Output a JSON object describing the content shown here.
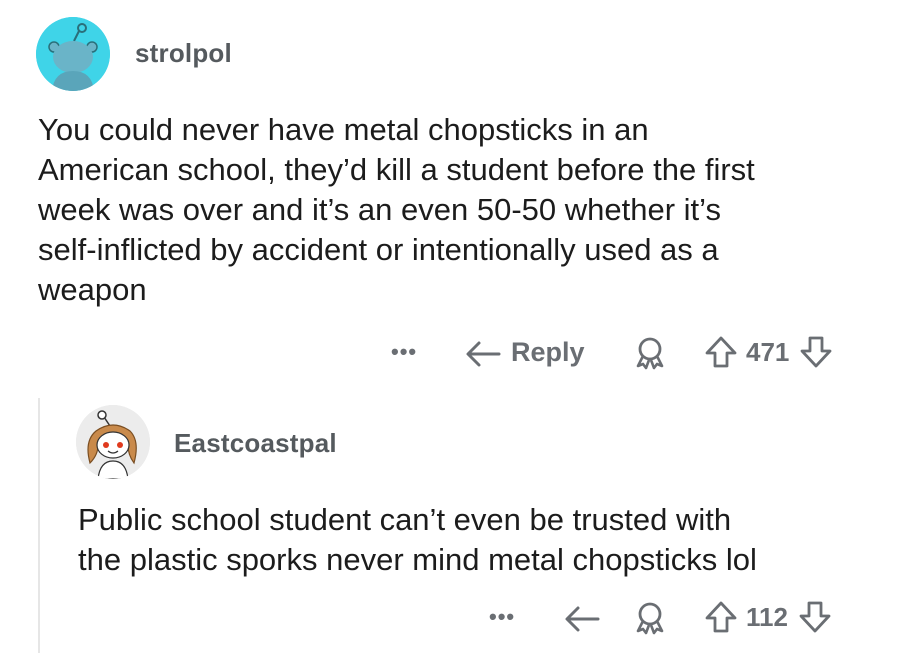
{
  "comments": [
    {
      "username": "strolpol",
      "body_lines": [
        "You could never have metal chopsticks in an",
        "American school, they’d kill a student before the first",
        "week was over and it’s an even 50-50 whether it’s",
        "self-inflicted by accident or intentionally used as a",
        "weapon"
      ],
      "more_label": "•••",
      "reply_label": "Reply",
      "score": "471",
      "avatar_icon": "snoo-avatar-icon",
      "avatar_color": "#3fd4e8"
    },
    {
      "username": "Eastcoastpal",
      "body_lines": [
        "Public school student can’t even be trusted with",
        "the plastic sporks never mind metal chopsticks lol"
      ],
      "more_label": "•••",
      "score": "112",
      "avatar_icon": "snoo-girl-avatar-icon",
      "avatar_color": "#e9e9e9"
    }
  ],
  "icons": {
    "reply": "reply-arrow-icon",
    "award": "award-icon",
    "upvote": "upvote-arrow-icon",
    "downvote": "downvote-arrow-icon"
  }
}
